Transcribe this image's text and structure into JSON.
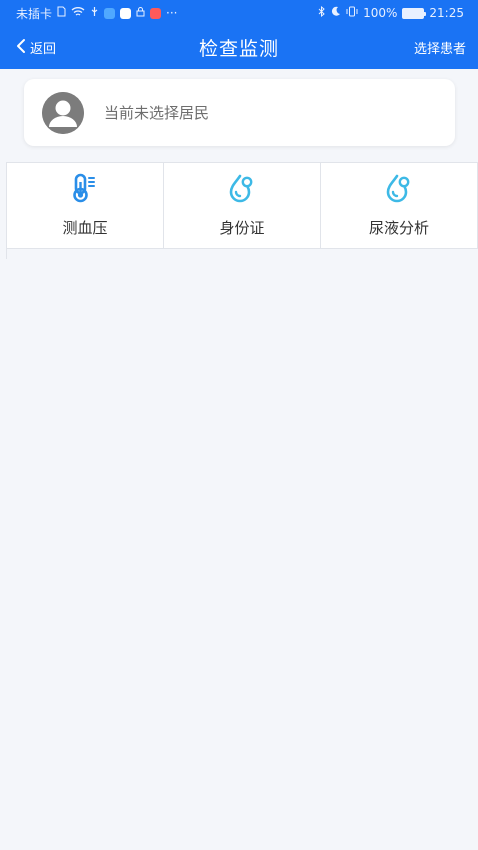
{
  "status_bar": {
    "carrier": "未插卡",
    "battery_percent": "100%",
    "time": "21:25",
    "more": "···",
    "icons": [
      "sim-icon",
      "wifi-icon",
      "usb-icon",
      "app-badge-icon",
      "message-icon",
      "lock-icon",
      "notification-icon",
      "bluetooth-icon",
      "moon-icon",
      "vibrate-icon",
      "battery-icon"
    ]
  },
  "navbar": {
    "back_label": "返回",
    "title": "检查监测",
    "right_action": "选择患者"
  },
  "resident": {
    "placeholder": "当前未选择居民"
  },
  "menu": [
    {
      "label": "测血压",
      "icon": "thermometer-icon"
    },
    {
      "label": "身份证",
      "icon": "water-drop-icon"
    },
    {
      "label": "尿液分析",
      "icon": "water-drop-icon"
    }
  ],
  "colors": {
    "primary": "#1a73f4",
    "icon_blue": "#2a8ee8",
    "icon_cyan": "#3db9e6",
    "background": "#f4f6fa"
  }
}
